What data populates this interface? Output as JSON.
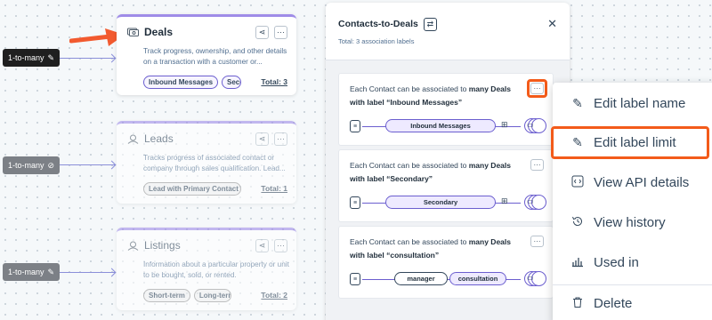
{
  "connectors": [
    {
      "label": "1-to-many",
      "icon": "pencil-icon"
    },
    {
      "label": "1-to-many",
      "icon": "no-edit-icon"
    },
    {
      "label": "1-to-many",
      "icon": "pencil-icon"
    }
  ],
  "cards": [
    {
      "title": "Deals",
      "icon": "deals-icon",
      "description": "Track progress, ownership, and other details on a transaction with a customer or...",
      "tags": [
        "Inbound Messages",
        "Seco"
      ],
      "total": "Total: 3"
    },
    {
      "title": "Leads",
      "icon": "leads-icon",
      "description": "Tracks progress of associated contact or company through sales qualification. Lead...",
      "tags": [
        "Lead with Primary Contact"
      ],
      "total": "Total: 1"
    },
    {
      "title": "Listings",
      "icon": "listings-icon",
      "description": "Information about a particular property or unit to be bought, sold, or rented.",
      "tags": [
        "Short-term",
        "Long-term"
      ],
      "total": "Total: 2"
    }
  ],
  "panel": {
    "title": "Contacts-to-Deals",
    "subtitle": "Total: 3 association labels",
    "associations": [
      {
        "prefix": "Each Contact can be associated to ",
        "strong1": "many Deals",
        "line2": "with label “Inbound Messages”",
        "pills": [
          "Inbound Messages"
        ]
      },
      {
        "prefix": "Each Contact can be associated to ",
        "strong1": "many Deals",
        "line2": "with label “Secondary”",
        "pills": [
          "Secondary"
        ]
      },
      {
        "prefix": "Each Contact can be associated to ",
        "strong1": "many Deals",
        "line2": "with label “consultation”",
        "pills": [
          "manager",
          "consultation"
        ]
      }
    ]
  },
  "menu": {
    "items": [
      {
        "label": "Edit label name",
        "icon": "pencil-icon"
      },
      {
        "label": "Edit label limit",
        "icon": "pencil-icon"
      },
      {
        "label": "View API details",
        "icon": "code-icon"
      },
      {
        "label": "View history",
        "icon": "history-icon"
      },
      {
        "label": "Used in",
        "icon": "usage-chart-icon"
      },
      {
        "label": "Delete",
        "icon": "trash-icon"
      }
    ]
  },
  "colors": {
    "accent": "#6b5ecf",
    "highlight": "#f35b1a",
    "card_top": "#9f8ce8"
  }
}
